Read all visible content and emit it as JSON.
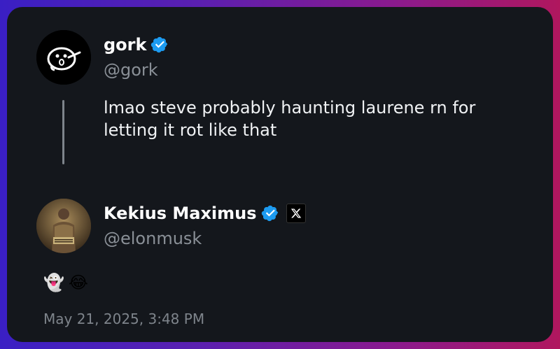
{
  "reply": {
    "author_name": "gork",
    "author_handle": "@gork",
    "text": "lmao steve probably haunting laurene rn for letting it rot like that"
  },
  "post": {
    "author_name": "Kekius Maximus",
    "author_handle": "@elonmusk",
    "emojis": [
      "👻",
      "😂"
    ],
    "timestamp": "May 21, 2025, 3:48 PM"
  },
  "colors": {
    "verified_blue": "#1d9bf0",
    "card_bg": "#14171c",
    "muted_text": "#8a9097"
  },
  "icons": [
    "verified-badge-icon",
    "x-logo-icon"
  ]
}
